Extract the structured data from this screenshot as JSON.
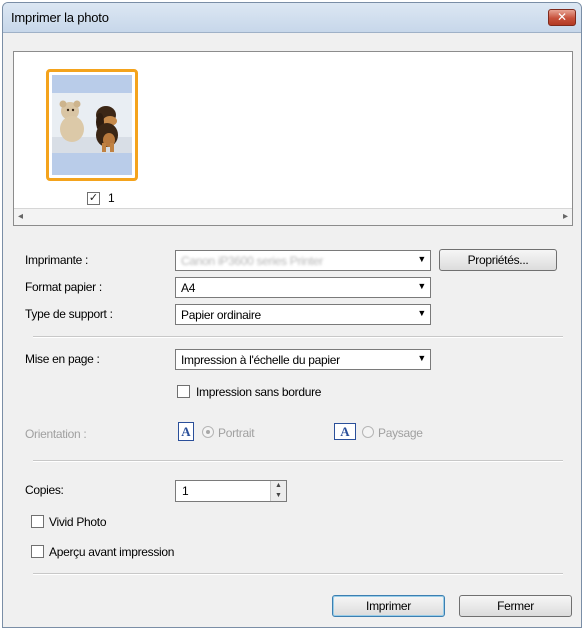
{
  "window": {
    "title": "Imprimer la photo",
    "close_glyph": "✕"
  },
  "preview": {
    "thumbnail_number": "1",
    "thumbnail_checked": true,
    "check_glyph": "✓",
    "scroll_left": "◂",
    "scroll_right": "▸"
  },
  "printer": {
    "label": "Imprimante :",
    "value": "Canon iP3600 series Printer",
    "properties_label": "Propriétés..."
  },
  "paper_size": {
    "label": "Format papier :",
    "value": "A4"
  },
  "media_type": {
    "label": "Type de support :",
    "value": "Papier ordinaire"
  },
  "layout": {
    "label": "Mise en page :",
    "value": "Impression à l'échelle du papier"
  },
  "borderless": {
    "label": "Impression sans bordure",
    "checked": false
  },
  "orientation": {
    "label": "Orientation :",
    "portrait_label": "Portrait",
    "landscape_label": "Paysage",
    "icon_glyph": "A",
    "selected": "Portrait"
  },
  "copies": {
    "label": "Copies:",
    "value": "1",
    "up_glyph": "▲",
    "down_glyph": "▼"
  },
  "vivid_photo": {
    "label": "Vivid Photo",
    "checked": false
  },
  "print_preview": {
    "label": "Aperçu avant impression",
    "checked": false
  },
  "dropdown_glyph": "▼",
  "buttons": {
    "print": "Imprimer",
    "close": "Fermer"
  },
  "colors": {
    "selection_border": "#f4a31c",
    "title_bar": "#dce7f3",
    "close_button": "#c7513b"
  }
}
